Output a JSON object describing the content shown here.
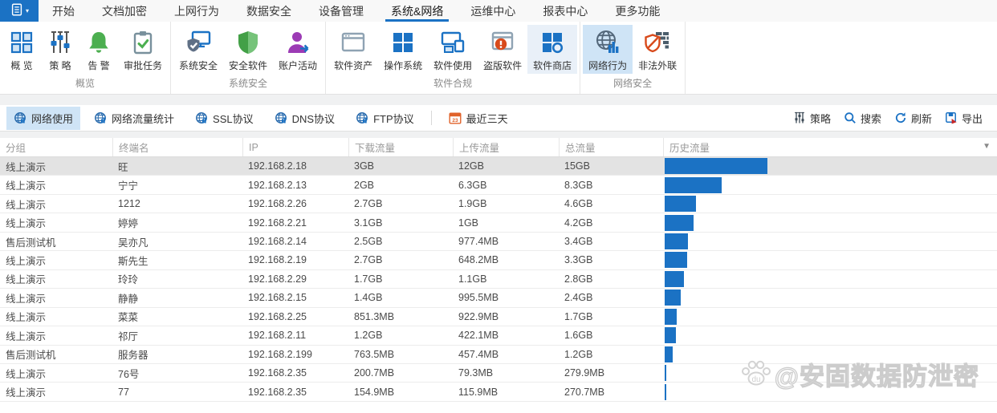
{
  "menubar": {
    "tabs": [
      {
        "label": "开始",
        "active": false
      },
      {
        "label": "文档加密",
        "active": false
      },
      {
        "label": "上网行为",
        "active": false
      },
      {
        "label": "数据安全",
        "active": false
      },
      {
        "label": "设备管理",
        "active": false
      },
      {
        "label": "系统&网络",
        "active": true
      },
      {
        "label": "运维中心",
        "active": false
      },
      {
        "label": "报表中心",
        "active": false
      },
      {
        "label": "更多功能",
        "active": false
      }
    ]
  },
  "ribbon": {
    "groups": [
      {
        "label": "概览",
        "items": [
          {
            "label": "概 览",
            "icon": "grid-icon",
            "state": "normal"
          },
          {
            "label": "策 略",
            "icon": "sliders-icon",
            "state": "normal"
          },
          {
            "label": "告 警",
            "icon": "bell-icon",
            "state": "normal"
          },
          {
            "label": "审批任务",
            "icon": "clipboard-check-icon",
            "state": "normal"
          }
        ]
      },
      {
        "label": "系统安全",
        "items": [
          {
            "label": "系统安全",
            "icon": "monitor-shield-icon",
            "state": "normal"
          },
          {
            "label": "安全软件",
            "icon": "shield-check-icon",
            "state": "normal"
          },
          {
            "label": "账户活动",
            "icon": "user-activity-icon",
            "state": "normal"
          }
        ]
      },
      {
        "label": "软件合规",
        "items": [
          {
            "label": "软件资产",
            "icon": "app-window-icon",
            "state": "normal"
          },
          {
            "label": "操作系统",
            "icon": "windows-icon",
            "state": "normal"
          },
          {
            "label": "软件使用",
            "icon": "monitors-icon",
            "state": "normal"
          },
          {
            "label": "盗版软件",
            "icon": "window-alert-icon",
            "state": "normal"
          },
          {
            "label": "软件商店",
            "icon": "store-icon",
            "state": "hover"
          }
        ]
      },
      {
        "label": "网络安全",
        "items": [
          {
            "label": "网络行为",
            "icon": "globe-stats-icon",
            "state": "selected"
          },
          {
            "label": "非法外联",
            "icon": "shield-block-icon",
            "state": "normal"
          }
        ]
      }
    ]
  },
  "toolbar": {
    "views": [
      {
        "label": "网络使用",
        "icon": "globe-icon",
        "active": true
      },
      {
        "label": "网络流量统计",
        "icon": "globe-icon",
        "active": false
      },
      {
        "label": "SSL协议",
        "icon": "globe-icon",
        "active": false
      },
      {
        "label": "DNS协议",
        "icon": "globe-icon",
        "active": false
      },
      {
        "label": "FTP协议",
        "icon": "globe-icon",
        "active": false
      }
    ],
    "date_filter": {
      "label": "最近三天",
      "icon": "calendar-icon",
      "day": "23"
    },
    "actions": [
      {
        "label": "策略",
        "icon": "policy-sliders-icon"
      },
      {
        "label": "搜索",
        "icon": "search-icon"
      },
      {
        "label": "刷新",
        "icon": "refresh-icon"
      },
      {
        "label": "导出",
        "icon": "export-icon"
      }
    ]
  },
  "table": {
    "columns": [
      "分组",
      "终端名",
      "IP",
      "下载流量",
      "上传流量",
      "总流量",
      "历史流量"
    ],
    "history_chart": {
      "type": "bar",
      "bar_color": "#1b72c4",
      "max_value_gb": 15
    },
    "rows": [
      {
        "group": "线上演示",
        "terminal": "旺",
        "ip": "192.168.2.18",
        "download": "3GB",
        "upload": "12GB",
        "total": "15GB",
        "history_gb": 15,
        "selected": true
      },
      {
        "group": "线上演示",
        "terminal": "宁宁",
        "ip": "192.168.2.13",
        "download": "2GB",
        "upload": "6.3GB",
        "total": "8.3GB",
        "history_gb": 8.3,
        "selected": false
      },
      {
        "group": "线上演示",
        "terminal": "1212",
        "ip": "192.168.2.26",
        "download": "2.7GB",
        "upload": "1.9GB",
        "total": "4.6GB",
        "history_gb": 4.6,
        "selected": false
      },
      {
        "group": "线上演示",
        "terminal": "婷婷",
        "ip": "192.168.2.21",
        "download": "3.1GB",
        "upload": "1GB",
        "total": "4.2GB",
        "history_gb": 4.2,
        "selected": false
      },
      {
        "group": "售后测试机",
        "terminal": "吴亦凡",
        "ip": "192.168.2.14",
        "download": "2.5GB",
        "upload": "977.4MB",
        "total": "3.4GB",
        "history_gb": 3.4,
        "selected": false
      },
      {
        "group": "线上演示",
        "terminal": "斯先生",
        "ip": "192.168.2.19",
        "download": "2.7GB",
        "upload": "648.2MB",
        "total": "3.3GB",
        "history_gb": 3.3,
        "selected": false
      },
      {
        "group": "线上演示",
        "terminal": "玲玲",
        "ip": "192.168.2.29",
        "download": "1.7GB",
        "upload": "1.1GB",
        "total": "2.8GB",
        "history_gb": 2.8,
        "selected": false
      },
      {
        "group": "线上演示",
        "terminal": "静静",
        "ip": "192.168.2.15",
        "download": "1.4GB",
        "upload": "995.5MB",
        "total": "2.4GB",
        "history_gb": 2.4,
        "selected": false
      },
      {
        "group": "线上演示",
        "terminal": "菜菜",
        "ip": "192.168.2.25",
        "download": "851.3MB",
        "upload": "922.9MB",
        "total": "1.7GB",
        "history_gb": 1.7,
        "selected": false
      },
      {
        "group": "线上演示",
        "terminal": "祁厅",
        "ip": "192.168.2.11",
        "download": "1.2GB",
        "upload": "422.1MB",
        "total": "1.6GB",
        "history_gb": 1.6,
        "selected": false
      },
      {
        "group": "售后测试机",
        "terminal": "服务器",
        "ip": "192.168.2.199",
        "download": "763.5MB",
        "upload": "457.4MB",
        "total": "1.2GB",
        "history_gb": 1.2,
        "selected": false
      },
      {
        "group": "线上演示",
        "terminal": "76号",
        "ip": "192.168.2.35",
        "download": "200.7MB",
        "upload": "79.3MB",
        "total": "279.9MB",
        "history_gb": 0.27,
        "selected": false
      },
      {
        "group": "线上演示",
        "terminal": "77",
        "ip": "192.168.2.35",
        "download": "154.9MB",
        "upload": "115.9MB",
        "total": "270.7MB",
        "history_gb": 0.26,
        "selected": false
      }
    ]
  },
  "watermark": {
    "text": "@安固数据防泄密",
    "paw_label": "du"
  },
  "colors": {
    "accent_blue": "#1b72c4",
    "selected_item_bg": "#cfe4f6",
    "hover_item_bg": "#e9f0f8",
    "bar_blue": "#1b72c4",
    "selected_row_bg": "#e3e3e3"
  }
}
